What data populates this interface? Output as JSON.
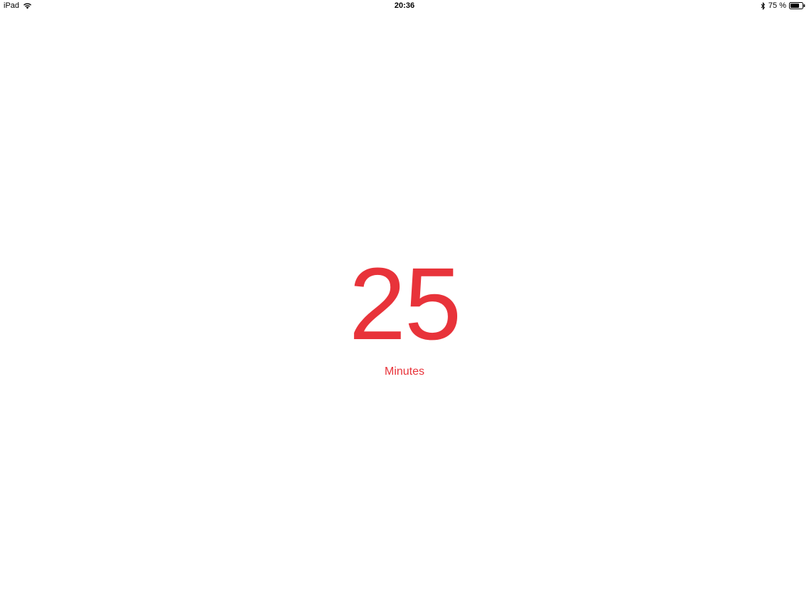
{
  "status_bar": {
    "device_label": "iPad",
    "time": "20:36",
    "battery_percent": "75 %",
    "battery_level": 0.75,
    "icons": [
      "wifi-icon",
      "bluetooth-icon",
      "battery-icon"
    ]
  },
  "timer": {
    "value": "25",
    "unit_label": "Minutes"
  },
  "colors": {
    "accent": "#e8333a",
    "background": "#ffffff",
    "status_text": "#000000"
  }
}
